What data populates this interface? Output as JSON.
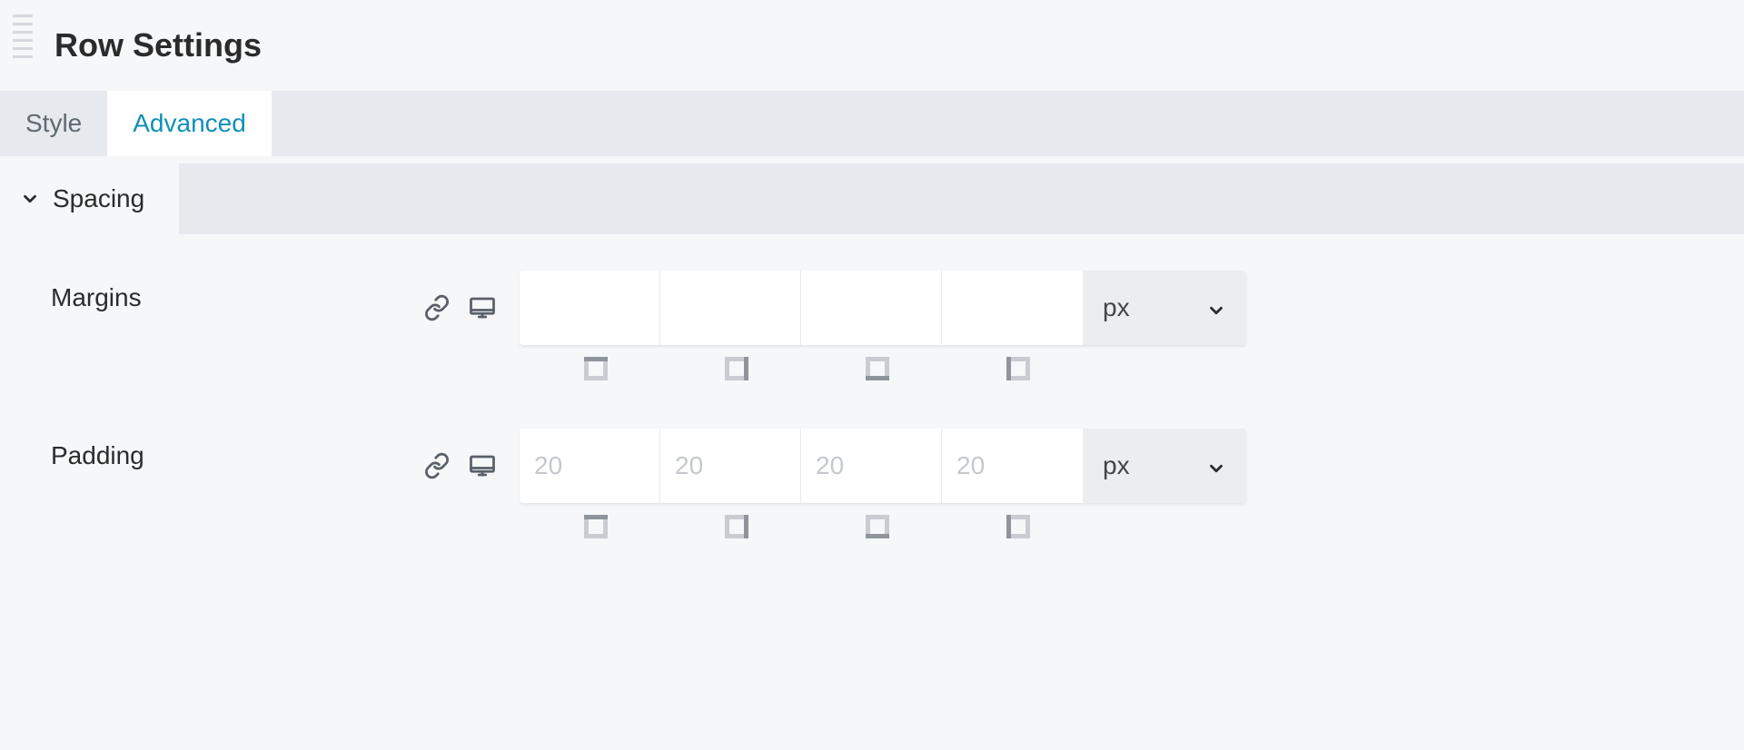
{
  "panel": {
    "title": "Row Settings"
  },
  "tabs": {
    "style": "Style",
    "advanced": "Advanced",
    "active": "advanced"
  },
  "section": {
    "spacing_label": "Spacing"
  },
  "margins": {
    "label": "Margins",
    "values": {
      "top": "",
      "right": "",
      "bottom": "",
      "left": ""
    },
    "placeholders": {
      "top": "",
      "right": "",
      "bottom": "",
      "left": ""
    },
    "unit": "px"
  },
  "padding": {
    "label": "Padding",
    "values": {
      "top": "",
      "right": "",
      "bottom": "",
      "left": ""
    },
    "placeholders": {
      "top": "20",
      "right": "20",
      "bottom": "20",
      "left": "20"
    },
    "unit": "px"
  },
  "icons": {
    "link": "link-icon",
    "responsive": "desktop-icon",
    "chevron": "chevron-down-icon"
  }
}
